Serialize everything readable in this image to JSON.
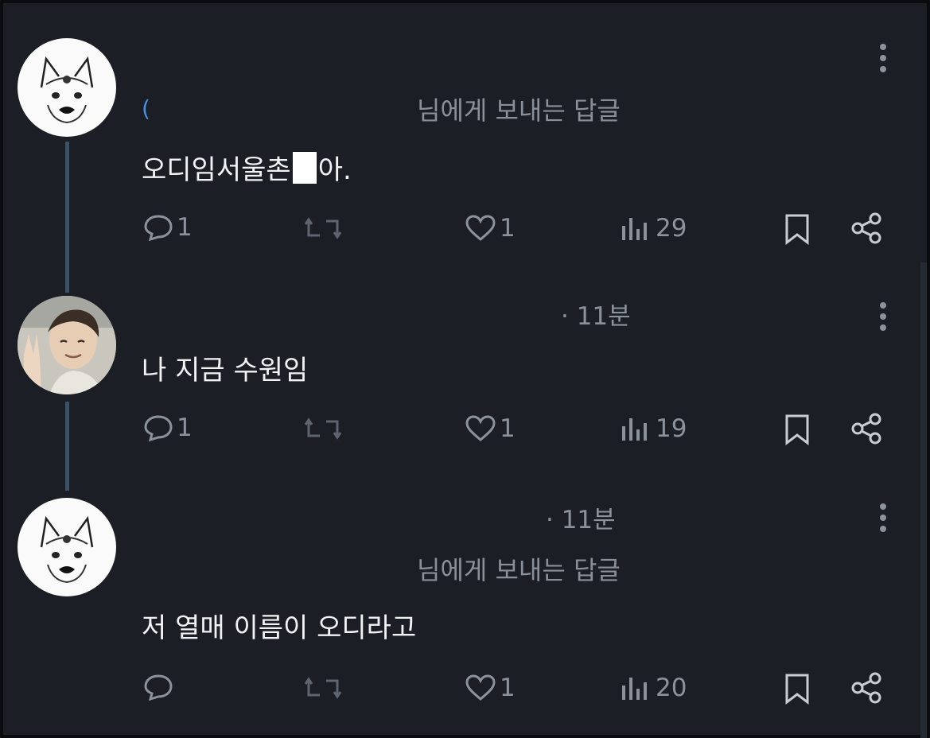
{
  "posts": [
    {
      "time": "",
      "reply_to": "님에게 보내는 답글",
      "handle_fragment": "(",
      "text_before": "오디임서울촌",
      "text_after": "아.",
      "actions": {
        "reply": "1",
        "repost": "",
        "like": "1",
        "views": "29"
      }
    },
    {
      "time": "· 11분",
      "reply_to": "",
      "text": "나 지금 수원임",
      "actions": {
        "reply": "1",
        "repost": "",
        "like": "1",
        "views": "19"
      }
    },
    {
      "time": "· 11분",
      "reply_to": "님에게 보내는 답글",
      "text": "저 열매 이름이 오디라고",
      "actions": {
        "reply": "",
        "repost": "",
        "like": "1",
        "views": "20"
      }
    }
  ],
  "icons": {
    "reply": "speech-bubble-icon",
    "repost": "repost-arrows-icon",
    "like": "heart-icon",
    "views": "bar-chart-icon",
    "bookmark": "bookmark-icon",
    "share": "share-icon",
    "more": "more-vertical-icon"
  },
  "colors": {
    "background": "#1b1e25",
    "muted": "#8c929c",
    "thread_line": "#3b5266",
    "text": "#f1f2f4"
  }
}
